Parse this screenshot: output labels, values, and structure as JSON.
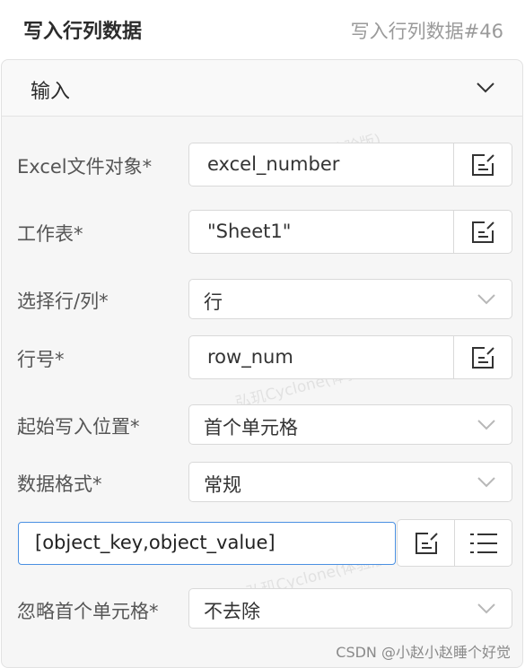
{
  "header": {
    "title": "写入行列数据",
    "node_id": "写入行列数据#46"
  },
  "section": {
    "title": "输入"
  },
  "fields": [
    {
      "label": "Excel文件对象*",
      "value": "excel_number",
      "kind": "text"
    },
    {
      "label": "工作表*",
      "value": "\"Sheet1\"",
      "kind": "text"
    },
    {
      "label": "选择行/列*",
      "value": "行",
      "kind": "select"
    },
    {
      "label": "行号*",
      "value": "row_num",
      "kind": "text"
    },
    {
      "label": "起始写入位置*",
      "value": "首个单元格",
      "kind": "select"
    },
    {
      "label": "数据格式*",
      "value": "常规",
      "kind": "select"
    },
    {
      "label": "忽略首个单元格*",
      "value": "不去除",
      "kind": "select"
    }
  ],
  "data_input": {
    "value": "[object_key,object_value]"
  },
  "watermark": "弘玑Cyclone(体验版)",
  "credit": "CSDN @小赵小赵睡个好觉",
  "icons": {
    "edit": "edit-icon",
    "list": "list-icon",
    "chevron": "chevron-down-icon"
  }
}
